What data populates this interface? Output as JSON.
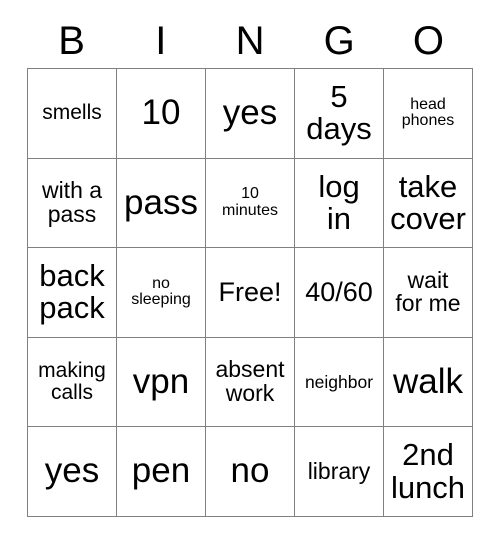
{
  "card": {
    "type": "bingo-card",
    "header": {
      "letters": [
        "B",
        "I",
        "N",
        "G",
        "O"
      ]
    },
    "grid": {
      "rows": 5,
      "columns": 5,
      "border_color": "#808080",
      "background_color": "#ffffff",
      "text_color": "#000000",
      "free_space": {
        "row": 2,
        "column": 2,
        "label": "Free!"
      },
      "cells": [
        [
          {
            "text": "smells",
            "size": "m"
          },
          {
            "text": "10",
            "size": "xxl"
          },
          {
            "text": "yes",
            "size": "xxl"
          },
          {
            "text": "5\ndays",
            "size": "xl"
          },
          {
            "text": "head\nphones",
            "size": "xs"
          }
        ],
        [
          {
            "text": "with a\npass",
            "size": "ml"
          },
          {
            "text": "pass",
            "size": "xxl"
          },
          {
            "text": "10\nminutes",
            "size": "xs"
          },
          {
            "text": "log\nin",
            "size": "xl"
          },
          {
            "text": "take\ncover",
            "size": "xl"
          }
        ],
        [
          {
            "text": "back\npack",
            "size": "xl"
          },
          {
            "text": "no\nsleeping",
            "size": "xs"
          },
          {
            "text": "Free!",
            "size": "l"
          },
          {
            "text": "40/60",
            "size": "l"
          },
          {
            "text": "wait\nfor me",
            "size": "ml"
          }
        ],
        [
          {
            "text": "making\ncalls",
            "size": "m"
          },
          {
            "text": "vpn",
            "size": "xxl"
          },
          {
            "text": "absent\nwork",
            "size": "ml"
          },
          {
            "text": "neighbor",
            "size": "s"
          },
          {
            "text": "walk",
            "size": "xxl"
          }
        ],
        [
          {
            "text": "yes",
            "size": "xxl"
          },
          {
            "text": "pen",
            "size": "xxl"
          },
          {
            "text": "no",
            "size": "xxl"
          },
          {
            "text": "library",
            "size": "ml"
          },
          {
            "text": "2nd\nlunch",
            "size": "xl"
          }
        ]
      ]
    }
  }
}
